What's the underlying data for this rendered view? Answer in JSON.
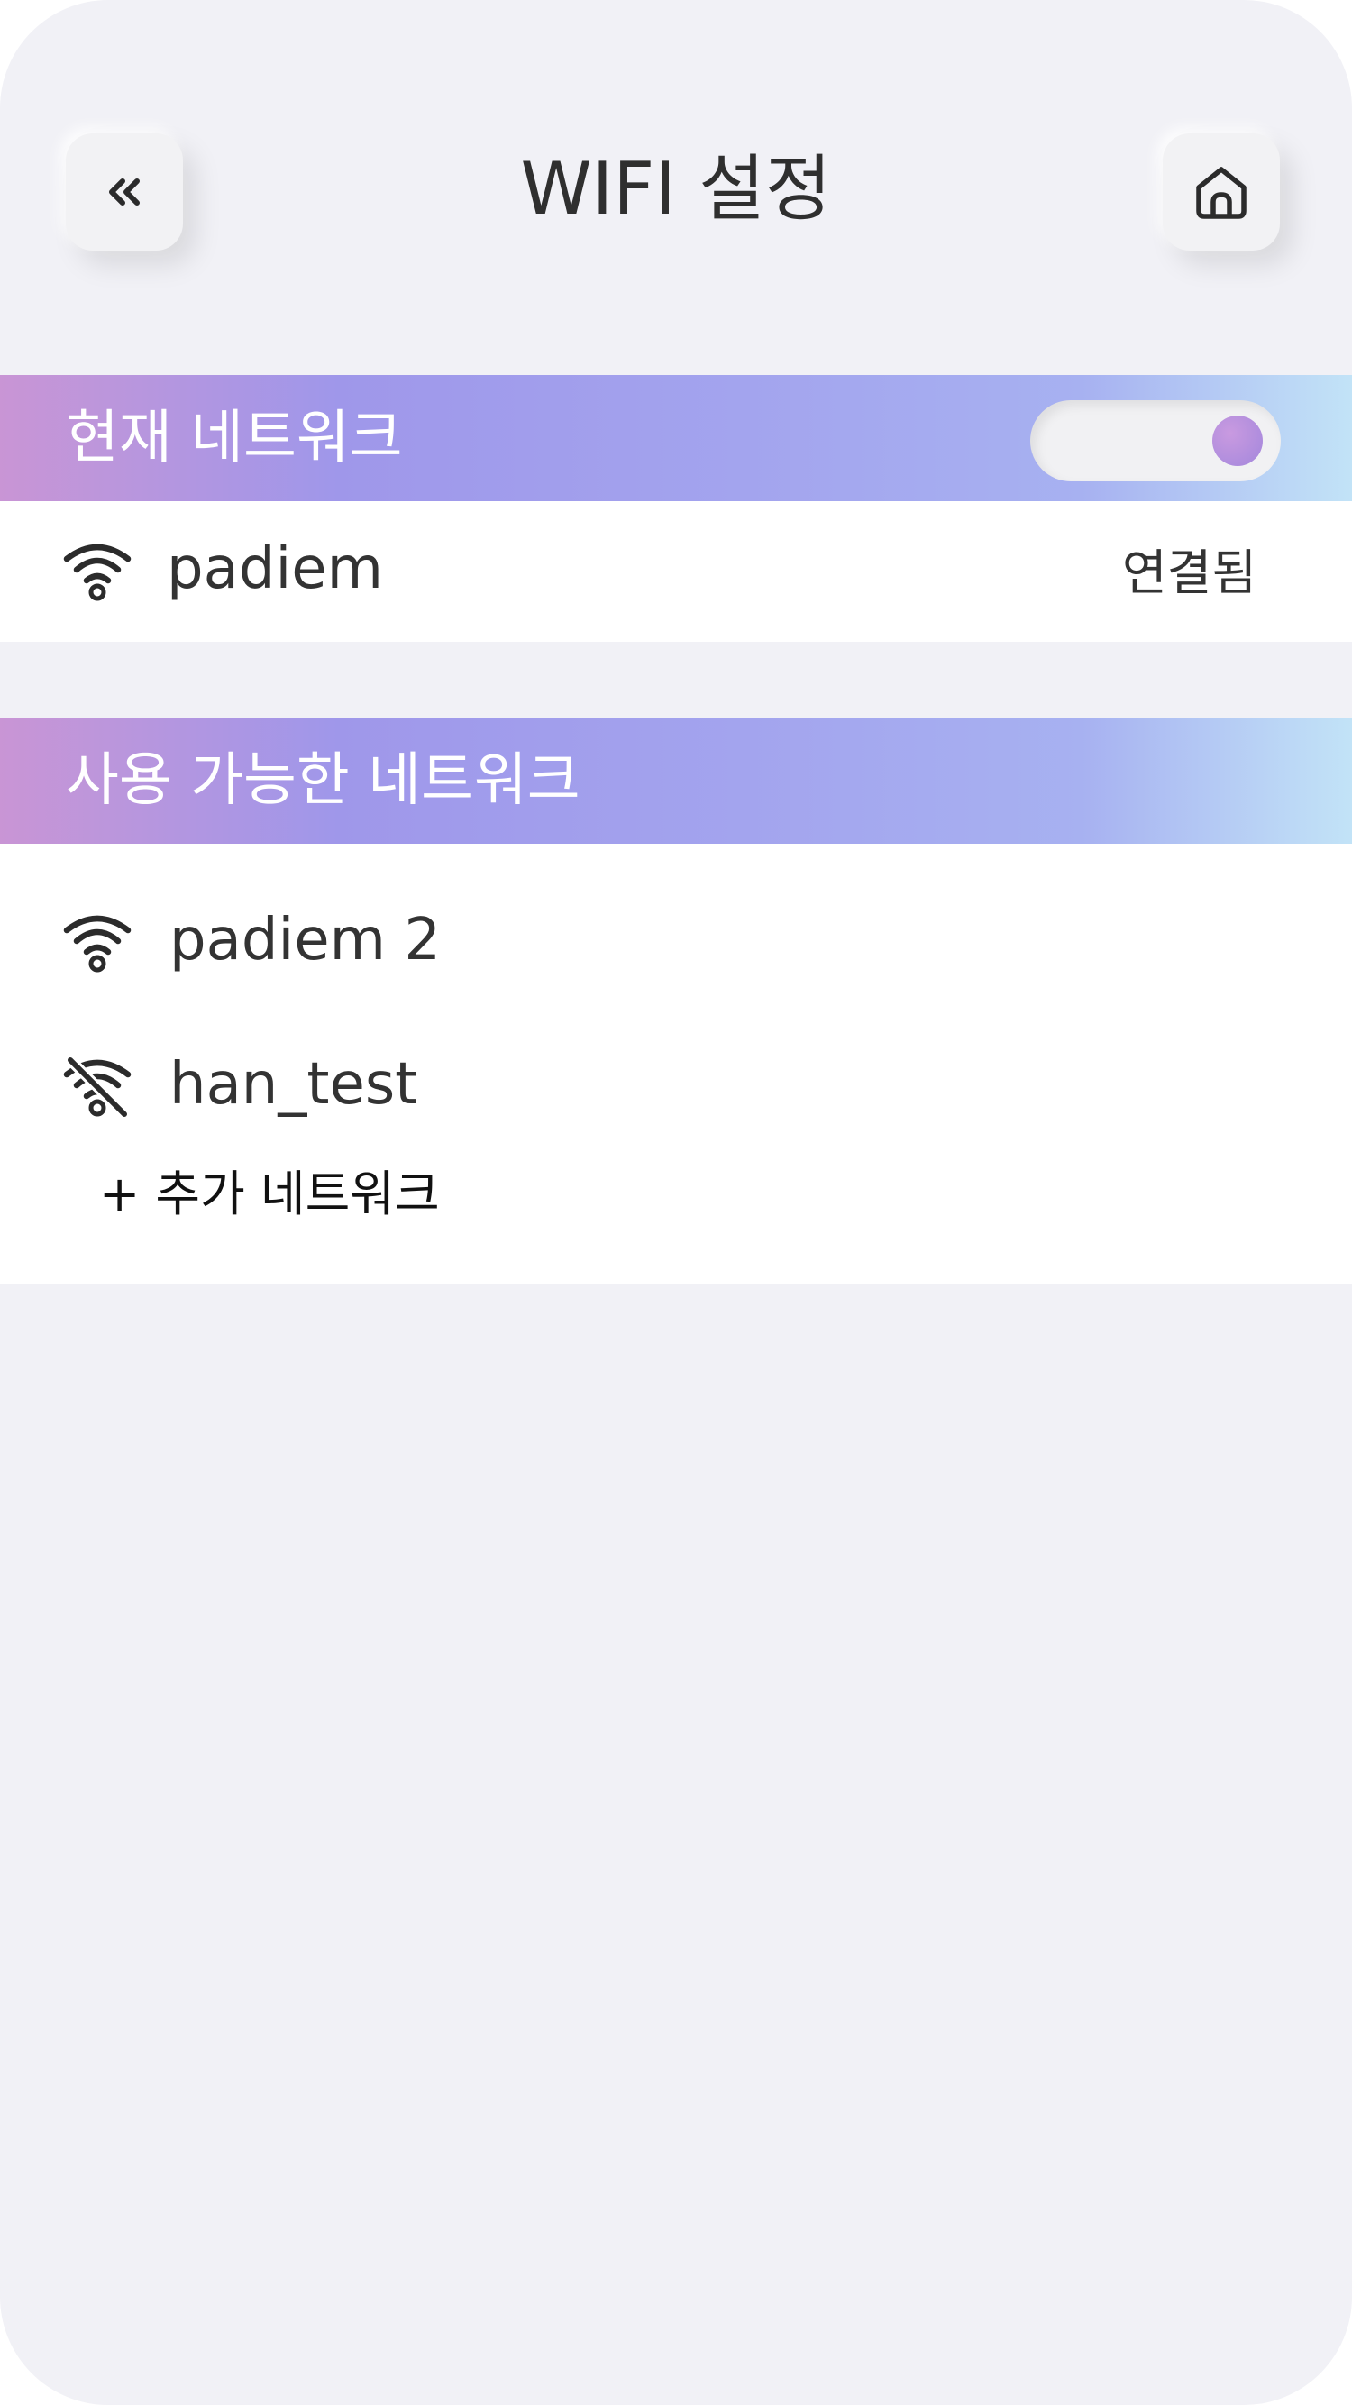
{
  "header": {
    "title": "WIFI 설정",
    "back_icon": "double-chevron-left-icon",
    "home_icon": "home-icon"
  },
  "current_network": {
    "section_title": "현재 네트워크",
    "wifi_enabled": true,
    "network": {
      "name": "padiem",
      "status": "연결됨",
      "icon": "wifi-icon"
    }
  },
  "available_networks": {
    "section_title": "사용 가능한 네트워크",
    "items": [
      {
        "name": "padiem 2",
        "icon": "wifi-icon"
      },
      {
        "name": "han_test",
        "icon": "wifi-off-icon"
      }
    ],
    "add_label": "+ 추가 네트워크"
  },
  "colors": {
    "background": "#f1f1f6",
    "gradient_start": "#c995d5",
    "gradient_mid": "#9f97ea",
    "gradient_end": "#c2e3f7",
    "toggle_knob": "#b190de",
    "text": "#333333"
  }
}
